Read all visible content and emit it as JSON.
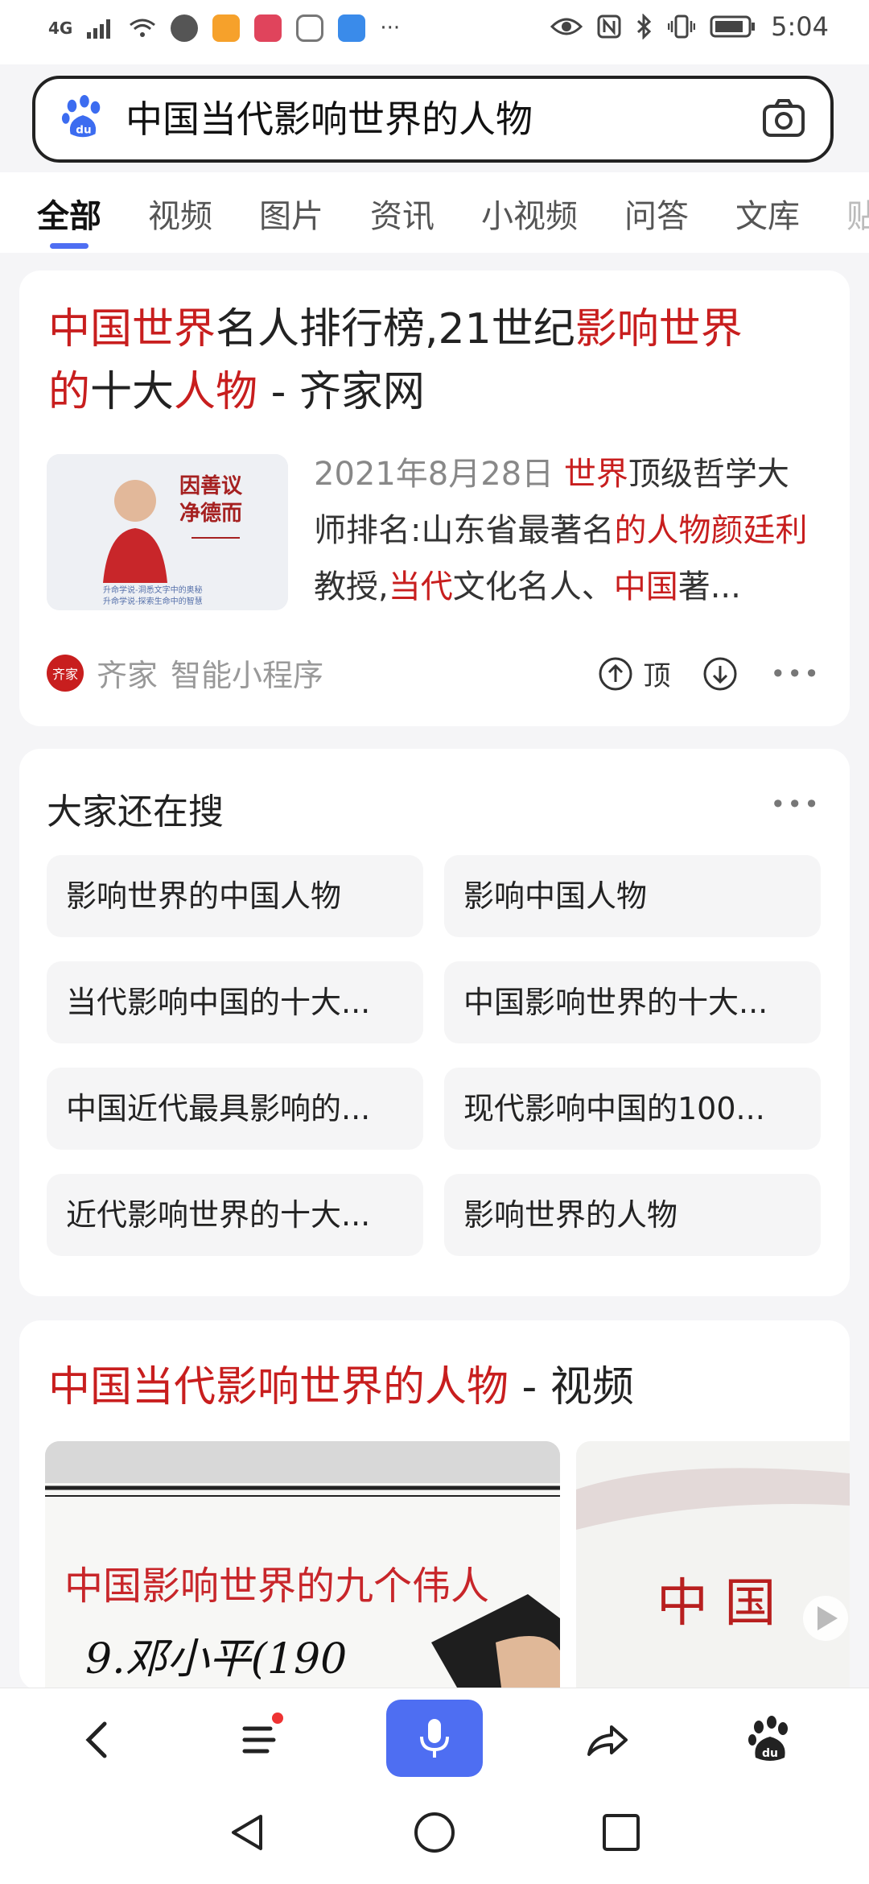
{
  "status_bar": {
    "network": "4G",
    "more": "···",
    "time": "5:04"
  },
  "search": {
    "query": "中国当代影响世界的人物"
  },
  "tabs": [
    "全部",
    "视频",
    "图片",
    "资讯",
    "小视频",
    "问答",
    "文库",
    "贴"
  ],
  "result": {
    "title_parts": [
      "中国世界",
      "名人排行榜,21世纪",
      "影响世界",
      "的",
      "十大",
      "人物",
      " - 齐家网"
    ],
    "date": "2021年8月28日",
    "desc_parts": [
      "世界",
      "顶级哲学大师排名:山东省最著名",
      "的人物颜廷利",
      "教授,",
      "当代",
      "文化名人、",
      "中国",
      "著..."
    ],
    "source_badge": "齐家",
    "source_name": "齐家",
    "source_type": "智能小程序",
    "top_label": "顶"
  },
  "also_search": {
    "title": "大家还在搜",
    "items": [
      "影响世界的中国人物",
      "影响中国人物",
      "当代影响中国的十大...",
      "中国影响世界的十大...",
      "中国近代最具影响的...",
      "现代影响中国的100...",
      "近代影响世界的十大...",
      "影响世界的人物"
    ]
  },
  "video": {
    "title_red": "中国当代影响世界的人物",
    "title_suffix": " - 视频",
    "v1_caption": "中国影响世界的九个伟人",
    "v1_line2": "9.邓小平(190",
    "v2_chars": "中 国"
  },
  "colors": {
    "accent": "#4e6ef2",
    "highlight_red": "#c81e1e"
  }
}
